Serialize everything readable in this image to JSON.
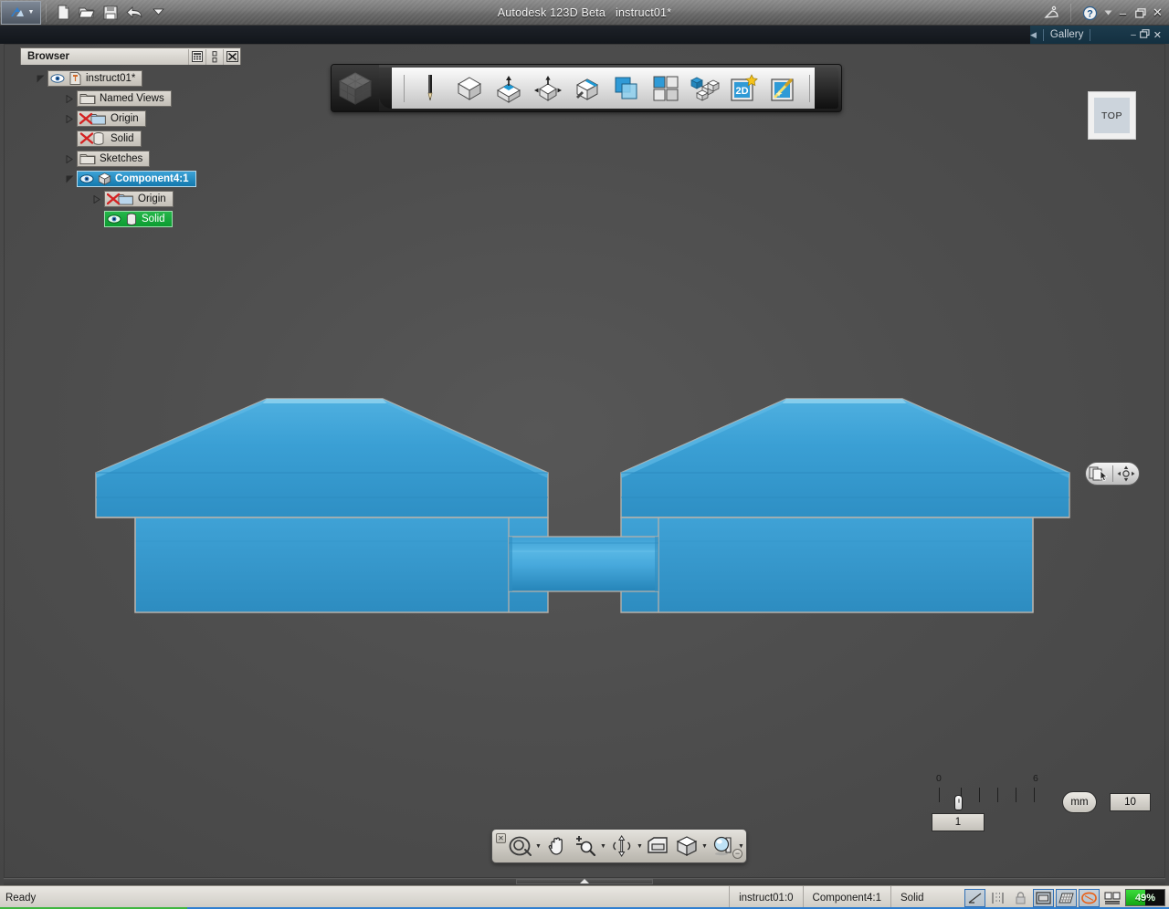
{
  "app": {
    "title": "Autodesk 123D Beta",
    "document": "instruct01*",
    "logo_icon": "autodesk-123d-logo-icon",
    "logo_caret_icon": "chevron-down-icon"
  },
  "titlebar": {
    "quick_access": [
      {
        "name": "new-file-button",
        "icon": "new-document-icon",
        "label": "New"
      },
      {
        "name": "open-file-button",
        "icon": "open-folder-icon",
        "label": "Open"
      },
      {
        "name": "save-file-button",
        "icon": "floppy-disk-icon",
        "label": "Save"
      },
      {
        "name": "undo-button",
        "icon": "undo-arrow-icon",
        "label": "Undo"
      },
      {
        "name": "quick-access-more-button",
        "icon": "chevron-down-icon",
        "label": "More"
      }
    ],
    "right_tools": [
      {
        "name": "satellite-status-button",
        "icon": "satellite-dish-icon",
        "label": "Connection"
      },
      {
        "name": "help-button",
        "icon": "question-circle-icon",
        "label": "Help"
      },
      {
        "name": "help-dropdown-button",
        "icon": "chevron-down-icon",
        "label": "Help menu"
      }
    ],
    "window_controls": [
      {
        "name": "window-minimize-button",
        "glyph": "–",
        "label": "Minimize"
      },
      {
        "name": "window-restore-button",
        "glyph": "❐",
        "label": "Restore"
      },
      {
        "name": "window-close-button",
        "glyph": "✕",
        "label": "Close"
      }
    ]
  },
  "gallery": {
    "arrow_icon": "triangle-left-icon",
    "label": "Gallery"
  },
  "document_window_controls": [
    {
      "name": "doc-minimize-button",
      "glyph": "–",
      "label": "Minimize"
    },
    {
      "name": "doc-restore-button",
      "glyph": "❐",
      "label": "Restore"
    },
    {
      "name": "doc-close-button",
      "glyph": "✕",
      "label": "Close"
    }
  ],
  "browser": {
    "title": "Browser",
    "header_buttons": [
      {
        "name": "browser-filter-button",
        "icon": "list-filter-icon"
      },
      {
        "name": "browser-collapse-button",
        "icon": "vertical-dots-icon"
      },
      {
        "name": "browser-close-button",
        "icon": "close-x-icon"
      }
    ],
    "tree": [
      {
        "label": "instruct01*",
        "indent": 0,
        "expander": "expanded",
        "icons": [
          "eye-icon",
          "pin-document-icon"
        ],
        "state": "normal"
      },
      {
        "label": "Named Views",
        "indent": 1,
        "expander": "collapsed",
        "icons": [
          "folder-icon"
        ],
        "state": "normal"
      },
      {
        "label": "Origin",
        "indent": 1,
        "expander": "collapsed",
        "icons": [
          "hidden-x-icon",
          "folder-icon"
        ],
        "state": "normal"
      },
      {
        "label": "Solid",
        "indent": 1,
        "expander": "none",
        "icons": [
          "hidden-x-icon",
          "cylinder-icon"
        ],
        "state": "normal"
      },
      {
        "label": "Sketches",
        "indent": 1,
        "expander": "collapsed",
        "icons": [
          "folder-icon"
        ],
        "state": "normal"
      },
      {
        "label": "Component4:1",
        "indent": 1,
        "expander": "expanded",
        "icons": [
          "eye-icon",
          "cube-icon"
        ],
        "state": "selected"
      },
      {
        "label": "Origin",
        "indent": 2,
        "expander": "collapsed",
        "icons": [
          "hidden-x-icon",
          "folder-icon"
        ],
        "state": "normal"
      },
      {
        "label": "Solid",
        "indent": 2,
        "expander": "none",
        "icons": [
          "eye-icon",
          "cylinder-icon"
        ],
        "state": "active"
      }
    ]
  },
  "toolbar": {
    "cube_logo_icon": "app-cube-icon",
    "items": [
      {
        "name": "sketch-tool-button",
        "icon": "pencil-icon",
        "label": "Sketch"
      },
      {
        "name": "primitives-tool-button",
        "icon": "cube-icon",
        "label": "Primitives"
      },
      {
        "name": "construct-tool-button",
        "icon": "cube-extrude-icon",
        "label": "Construct"
      },
      {
        "name": "modify-tool-button",
        "icon": "cube-arrows-icon",
        "label": "Modify"
      },
      {
        "name": "pattern-tool-button",
        "icon": "cube-edge-icon",
        "label": "Pattern"
      },
      {
        "name": "combine-tool-button",
        "icon": "combine-squares-icon",
        "label": "Combine"
      },
      {
        "name": "grid-tool-button",
        "icon": "four-squares-icon",
        "label": "Grid"
      },
      {
        "name": "assembly-tool-button",
        "icon": "cube-cluster-icon",
        "label": "Assembly"
      },
      {
        "name": "drawing-2d-button",
        "icon": "2d-star-icon",
        "label": "2D"
      },
      {
        "name": "material-tool-button",
        "icon": "magic-wand-icon",
        "label": "Material"
      }
    ]
  },
  "viewcube": {
    "face_label": "TOP"
  },
  "float_widget": [
    {
      "name": "select-object-button",
      "icon": "select-cursor-icon"
    },
    {
      "name": "move-widget-button",
      "icon": "four-way-move-icon"
    }
  ],
  "ruler": {
    "tick_labels": [
      {
        "text": "0",
        "pos": 12
      },
      {
        "text": "6",
        "pos": 118
      }
    ],
    "value": "1",
    "unit": "mm",
    "max_value": "10"
  },
  "navbar": {
    "close_glyph": "✕",
    "minimize_glyph": "−",
    "items": [
      {
        "name": "viewcube-nav-button",
        "icon": "orbit-circle-icon",
        "caret": true
      },
      {
        "name": "pan-tool-button",
        "icon": "hand-icon",
        "caret": false
      },
      {
        "name": "zoom-tool-button",
        "icon": "zoom-plus-minus-icon",
        "caret": true
      },
      {
        "name": "orbit-tool-button",
        "icon": "orbit-arrows-icon",
        "caret": true
      },
      {
        "name": "fit-view-button",
        "icon": "fit-window-icon",
        "caret": false
      },
      {
        "name": "display-mode-button",
        "icon": "display-cube-icon",
        "caret": true
      },
      {
        "name": "visual-style-button",
        "icon": "sphere-shading-icon",
        "caret": true
      }
    ]
  },
  "statusbar": {
    "message": "Ready",
    "cells": [
      "instruct01:0",
      "Component4:1",
      "Solid"
    ],
    "icons": [
      {
        "name": "snap-toggle-icon",
        "icon": "angle-snap-icon",
        "active": true
      },
      {
        "name": "measure-toggle-icon",
        "icon": "measure-icon",
        "active": false
      },
      {
        "name": "lock-toggle-icon",
        "icon": "padlock-icon",
        "active": false
      },
      {
        "name": "frame-toggle-icon",
        "icon": "frame-icon",
        "active": true
      },
      {
        "name": "grid-toggle-icon",
        "icon": "grid-plane-icon",
        "active": true
      },
      {
        "name": "sketch-toggle-icon",
        "icon": "orange-loop-icon",
        "active": true
      },
      {
        "name": "window-layout-icon",
        "icon": "dual-pane-icon",
        "active": false
      }
    ],
    "meter": {
      "label": "49%",
      "percent": 49
    }
  },
  "model": {
    "fill": "#3399cc",
    "fill_light": "#4aa8d8",
    "fill_dark": "#2b86b8",
    "outline": "#b5b1ab",
    "background": "#4e4e4e"
  }
}
